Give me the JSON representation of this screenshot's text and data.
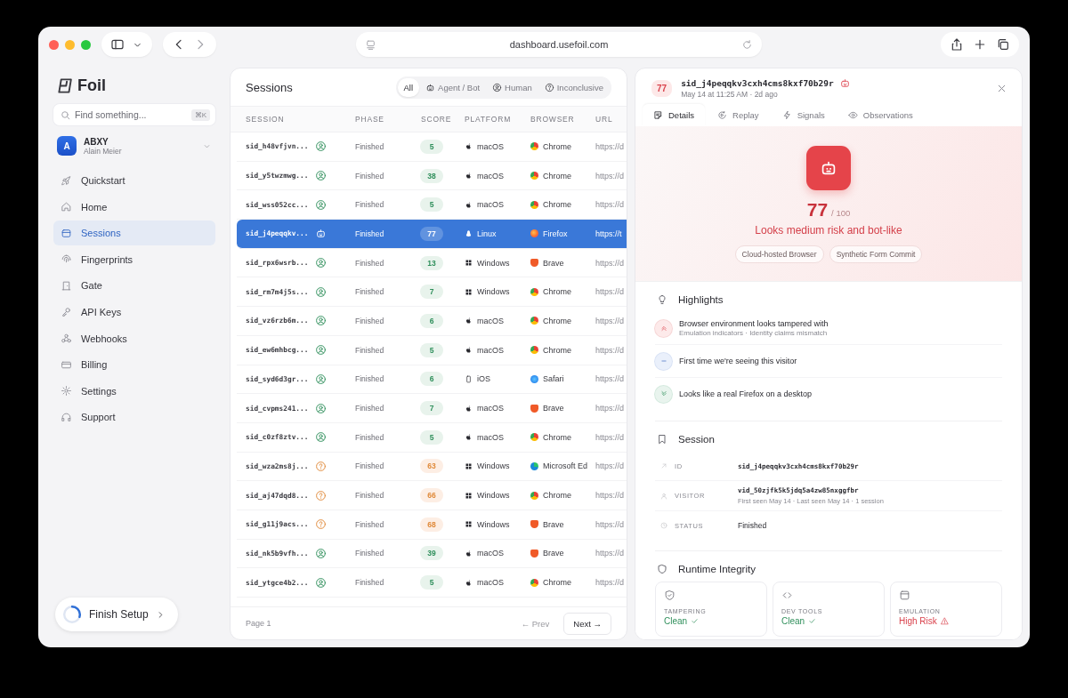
{
  "browser": {
    "url": "dashboard.usefoil.com"
  },
  "sidebar": {
    "brand": "Foil",
    "search": {
      "placeholder": "Find something...",
      "shortcut": "⌘K"
    },
    "account": {
      "initial": "A",
      "org": "ABXY",
      "user": "Alain Meier"
    },
    "items": [
      {
        "label": "Quickstart",
        "selected": false
      },
      {
        "label": "Home",
        "selected": false
      },
      {
        "label": "Sessions",
        "selected": true
      },
      {
        "label": "Fingerprints",
        "selected": false
      },
      {
        "label": "Gate",
        "selected": false
      },
      {
        "label": "API Keys",
        "selected": false
      },
      {
        "label": "Webhooks",
        "selected": false
      },
      {
        "label": "Billing",
        "selected": false
      },
      {
        "label": "Settings",
        "selected": false
      },
      {
        "label": "Support",
        "selected": false
      }
    ],
    "finish_setup": {
      "label": "Finish Setup",
      "level": 0.3
    }
  },
  "sessions": {
    "title": "Sessions",
    "filters": [
      {
        "label": "All",
        "kind": "all",
        "selected": true
      },
      {
        "label": "Agent / Bot",
        "kind": "bot",
        "selected": false
      },
      {
        "label": "Human",
        "kind": "human",
        "selected": false
      },
      {
        "label": "Inconclusive",
        "kind": "inconclusive",
        "selected": false
      }
    ],
    "columns": [
      "SESSION",
      "PHASE",
      "SCORE",
      "PLATFORM",
      "BROWSER",
      "URL"
    ],
    "rows": [
      {
        "session": "sid_h48vfjvn...",
        "kind": "human",
        "phase": "Finished",
        "score": "5",
        "platform": {
          "name": "macOS",
          "kind": "apple"
        },
        "browser": {
          "name": "Chrome",
          "kind": "chrome"
        },
        "url": "https://d",
        "selected": false
      },
      {
        "session": "sid_y5twzmwg...",
        "kind": "human",
        "phase": "Finished",
        "score": "38",
        "platform": {
          "name": "macOS",
          "kind": "apple"
        },
        "browser": {
          "name": "Chrome",
          "kind": "chrome"
        },
        "url": "https://d",
        "selected": false
      },
      {
        "session": "sid_wss052cc...",
        "kind": "human",
        "phase": "Finished",
        "score": "5",
        "platform": {
          "name": "macOS",
          "kind": "apple"
        },
        "browser": {
          "name": "Chrome",
          "kind": "chrome"
        },
        "url": "https://d",
        "selected": false
      },
      {
        "session": "sid_j4peqqkv...",
        "kind": "bot",
        "phase": "Finished",
        "score": "77",
        "platform": {
          "name": "Linux",
          "kind": "linux"
        },
        "browser": {
          "name": "Firefox",
          "kind": "firefox"
        },
        "url": "https://t",
        "selected": true
      },
      {
        "session": "sid_rpx6wsrb...",
        "kind": "human",
        "phase": "Finished",
        "score": "13",
        "platform": {
          "name": "Windows",
          "kind": "windows"
        },
        "browser": {
          "name": "Brave",
          "kind": "brave"
        },
        "url": "https://d",
        "selected": false
      },
      {
        "session": "sid_rm7m4j5s...",
        "kind": "human",
        "phase": "Finished",
        "score": "7",
        "platform": {
          "name": "Windows",
          "kind": "windows"
        },
        "browser": {
          "name": "Chrome",
          "kind": "chrome"
        },
        "url": "https://d",
        "selected": false
      },
      {
        "session": "sid_vz6rzb6m...",
        "kind": "human",
        "phase": "Finished",
        "score": "6",
        "platform": {
          "name": "macOS",
          "kind": "apple"
        },
        "browser": {
          "name": "Chrome",
          "kind": "chrome"
        },
        "url": "https://d",
        "selected": false
      },
      {
        "session": "sid_ew6mhbcg...",
        "kind": "human",
        "phase": "Finished",
        "score": "5",
        "platform": {
          "name": "macOS",
          "kind": "apple"
        },
        "browser": {
          "name": "Chrome",
          "kind": "chrome"
        },
        "url": "https://d",
        "selected": false
      },
      {
        "session": "sid_syd6d3gr...",
        "kind": "human",
        "phase": "Finished",
        "score": "6",
        "platform": {
          "name": "iOS",
          "kind": "phone"
        },
        "browser": {
          "name": "Safari",
          "kind": "safari"
        },
        "url": "https://d",
        "selected": false
      },
      {
        "session": "sid_cvpms241...",
        "kind": "human",
        "phase": "Finished",
        "score": "7",
        "platform": {
          "name": "macOS",
          "kind": "apple"
        },
        "browser": {
          "name": "Brave",
          "kind": "brave"
        },
        "url": "https://d",
        "selected": false
      },
      {
        "session": "sid_c0zf8ztv...",
        "kind": "human",
        "phase": "Finished",
        "score": "5",
        "platform": {
          "name": "macOS",
          "kind": "apple"
        },
        "browser": {
          "name": "Chrome",
          "kind": "chrome"
        },
        "url": "https://d",
        "selected": false
      },
      {
        "session": "sid_wza2ms8j...",
        "kind": "inconclusive",
        "phase": "Finished",
        "score": "63",
        "platform": {
          "name": "Windows",
          "kind": "windows"
        },
        "browser": {
          "name": "Microsoft Ed",
          "kind": "edge"
        },
        "url": "https://d",
        "selected": false
      },
      {
        "session": "sid_aj47dqd8...",
        "kind": "inconclusive",
        "phase": "Finished",
        "score": "66",
        "platform": {
          "name": "Windows",
          "kind": "windows"
        },
        "browser": {
          "name": "Chrome",
          "kind": "chrome"
        },
        "url": "https://d",
        "selected": false
      },
      {
        "session": "sid_g11j9acs...",
        "kind": "inconclusive",
        "phase": "Finished",
        "score": "68",
        "platform": {
          "name": "Windows",
          "kind": "windows"
        },
        "browser": {
          "name": "Brave",
          "kind": "brave"
        },
        "url": "https://d",
        "selected": false
      },
      {
        "session": "sid_nk5b9vfh...",
        "kind": "human",
        "phase": "Finished",
        "score": "39",
        "platform": {
          "name": "macOS",
          "kind": "apple"
        },
        "browser": {
          "name": "Brave",
          "kind": "brave"
        },
        "url": "https://d",
        "selected": false
      },
      {
        "session": "sid_ytgce4b2...",
        "kind": "human",
        "phase": "Finished",
        "score": "5",
        "platform": {
          "name": "macOS",
          "kind": "apple"
        },
        "browser": {
          "name": "Chrome",
          "kind": "chrome"
        },
        "url": "https://d",
        "selected": false
      }
    ],
    "page": "Page 1",
    "prev": {
      "label": "← Prev",
      "disabled": true
    },
    "next": {
      "label": "Next →",
      "disabled": false
    }
  },
  "detail": {
    "score": "77",
    "session_id": "sid_j4peqqkv3cxh4cms8kxf70b29r",
    "kind": "bot",
    "time": "May 14 at 11:25 AM · 2d ago",
    "tabs": [
      {
        "label": "Details",
        "selected": true
      },
      {
        "label": "Replay",
        "selected": false
      },
      {
        "label": "Signals",
        "selected": false
      },
      {
        "label": "Observations",
        "selected": false
      }
    ],
    "hero": {
      "score": "77",
      "out_of": "/ 100",
      "summary": "Looks medium risk and bot-like",
      "tags": [
        "Cloud-hosted Browser",
        "Synthetic Form Commit"
      ]
    },
    "highlights": {
      "title": "Highlights",
      "items": [
        {
          "kind": "risk",
          "text": "Browser environment looks tampered with",
          "detail": "Emulation indicators · Identity claims mismatch"
        },
        {
          "kind": "neutral",
          "text": "First time we're seeing this visitor"
        },
        {
          "kind": "trust",
          "text": "Looks like a real Firefox on a desktop"
        }
      ]
    },
    "session": {
      "title": "Session",
      "fields": [
        {
          "label": "ID",
          "kind": "mono",
          "value": "sid_j4peqqkv3cxh4cms8kxf70b29r"
        },
        {
          "label": "VISITOR",
          "kind": "mono",
          "value": "vid_50zjfk5k5jdq5a4zw85nxggfbr",
          "detail": "First seen May 14 · Last seen May 14 · 1 session"
        },
        {
          "label": "STATUS",
          "kind": "text",
          "value": "Finished"
        }
      ]
    },
    "runtime": {
      "title": "Runtime Integrity",
      "checks": [
        {
          "label": "TAMPERING",
          "value": "Clean",
          "kind": "clean"
        },
        {
          "label": "DEV TOOLS",
          "value": "Clean",
          "kind": "clean"
        },
        {
          "label": "EMULATION",
          "value": "High Risk",
          "kind": "risk"
        }
      ]
    }
  }
}
